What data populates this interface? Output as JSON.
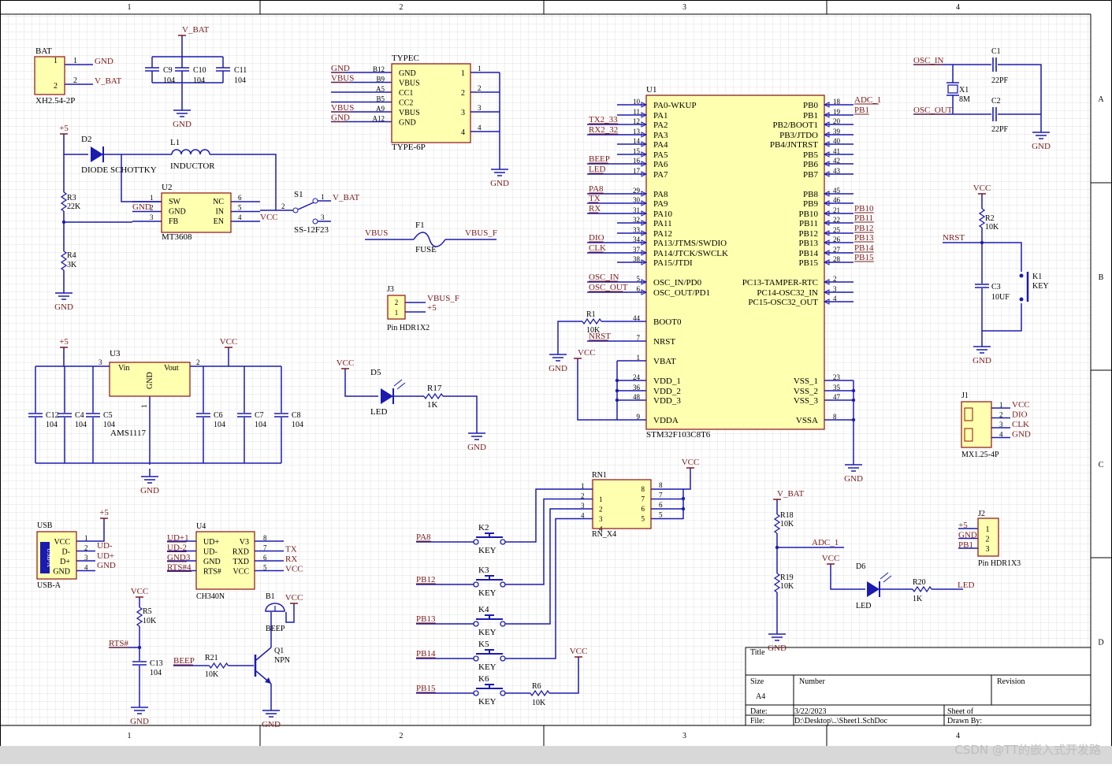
{
  "frame": {
    "columns": [
      "1",
      "2",
      "3",
      "4"
    ],
    "rows": [
      "A",
      "B",
      "C",
      "D"
    ]
  },
  "title_block": {
    "title_label": "Title",
    "size_label": "Size",
    "size_value": "A4",
    "number_label": "Number",
    "revision_label": "Revision",
    "date_label": "Date:",
    "date_value": "3/22/2023",
    "file_label": "File:",
    "file_value": "D:\\Desktop\\..\\Sheet1.SchDoc",
    "sheet_label": "Sheet  of",
    "drawn_label": "Drawn By:"
  },
  "watermark": "CSDN @TT的嵌入式开发路",
  "components": {
    "bat": {
      "ref": "BAT",
      "value": "XH2.54-2P",
      "pins": [
        "1",
        "2"
      ],
      "nets": [
        "GND",
        "V_BAT"
      ]
    },
    "caps_top": {
      "net_top": "V_BAT",
      "net_bottom": "GND",
      "refs": [
        "C9",
        "C10",
        "C11"
      ],
      "values": [
        "104",
        "104",
        "104"
      ]
    },
    "typec": {
      "ref": "TYPEC",
      "value": "TYPE-6P",
      "left_nets": [
        "GND",
        "VBUS",
        "",
        "",
        "VBUS",
        "GND"
      ],
      "left_pins": [
        "B12",
        "B9",
        "A5",
        "B5",
        "A9",
        "A12"
      ],
      "labels": [
        "GND",
        "VBUS",
        "CC1",
        "CC2",
        "VBUS",
        "GND"
      ],
      "right_pins": [
        "1",
        "2",
        "3",
        "4"
      ],
      "gnd": "GND"
    },
    "boost": {
      "ref": "U2",
      "value": "MT3608",
      "d2": "D2",
      "d2_value": "DIODE SCHOTTKY",
      "l1": "L1",
      "l1_value": "INDUCTOR",
      "labels_left": [
        "SW",
        "GND",
        "FB"
      ],
      "labels_right": [
        "NC",
        "IN",
        "EN"
      ],
      "pins_left": [
        "1",
        "2",
        "3"
      ],
      "pins_right": [
        "6",
        "5",
        "4"
      ],
      "plus5": "+5",
      "gnd_net": "GND",
      "vcc_net": "VCC",
      "r3": "R3",
      "r3_value": "22K",
      "r4": "R4",
      "r4_value": "3K",
      "gnd": "GND"
    },
    "switch": {
      "ref": "S1",
      "value": "SS-12F23",
      "net": "V_BAT",
      "pins": [
        "1",
        "2",
        "3"
      ]
    },
    "fuse": {
      "ref": "F1",
      "value": "FUSE",
      "net_in": "VBUS",
      "net_out": "VBUS_F"
    },
    "j3": {
      "ref": "J3",
      "value": "Pin HDR1X2",
      "pins": [
        "2",
        "1"
      ],
      "nets": [
        "VBUS_F",
        "+5"
      ]
    },
    "mcu": {
      "ref": "U1",
      "value": "STM32F103C8T6",
      "left": [
        {
          "pin": "10",
          "label": "PA0-WKUP",
          "net": ""
        },
        {
          "pin": "11",
          "label": "PA1",
          "net": ""
        },
        {
          "pin": "12",
          "label": "PA2",
          "net": "TX2_33"
        },
        {
          "pin": "13",
          "label": "PA3",
          "net": "RX2_32"
        },
        {
          "pin": "14",
          "label": "PA4",
          "net": ""
        },
        {
          "pin": "15",
          "label": "PA5",
          "net": ""
        },
        {
          "pin": "16",
          "label": "PA6",
          "net": "BEEP"
        },
        {
          "pin": "17",
          "label": "PA7",
          "net": "LED"
        },
        {
          "pin": "29",
          "label": "PA8",
          "net": "PA8"
        },
        {
          "pin": "30",
          "label": "PA9",
          "net": "TX"
        },
        {
          "pin": "31",
          "label": "PA10",
          "net": "RX"
        },
        {
          "pin": "32",
          "label": "PA11",
          "net": ""
        },
        {
          "pin": "33",
          "label": "PA12",
          "net": ""
        },
        {
          "pin": "34",
          "label": "PA13/JTMS/SWDIO",
          "net": "DIO"
        },
        {
          "pin": "37",
          "label": "PA14/JTCK/SWCLK",
          "net": "CLK"
        },
        {
          "pin": "38",
          "label": "PA15/JTDI",
          "net": ""
        },
        {
          "pin": "5",
          "label": "OSC_IN/PD0",
          "net": "OSC_IN"
        },
        {
          "pin": "6",
          "label": "OSC_OUT/PD1",
          "net": "OSC_OUT"
        },
        {
          "pin": "44",
          "label": "BOOT0",
          "net": ""
        },
        {
          "pin": "7",
          "label": "NRST",
          "net": "NRST"
        },
        {
          "pin": "1",
          "label": "VBAT",
          "net": ""
        },
        {
          "pin": "24",
          "label": "VDD_1",
          "net": ""
        },
        {
          "pin": "36",
          "label": "VDD_2",
          "net": ""
        },
        {
          "pin": "48",
          "label": "VDD_3",
          "net": ""
        },
        {
          "pin": "9",
          "label": "VDDA",
          "net": ""
        }
      ],
      "right": [
        {
          "pin": "18",
          "label": "PB0",
          "net": "ADC_1"
        },
        {
          "pin": "19",
          "label": "PB1",
          "net": "PB1"
        },
        {
          "pin": "20",
          "label": "PB2/BOOT1",
          "net": ""
        },
        {
          "pin": "39",
          "label": "PB3/JTDO",
          "net": ""
        },
        {
          "pin": "40",
          "label": "PB4/JNTRST",
          "net": ""
        },
        {
          "pin": "41",
          "label": "PB5",
          "net": ""
        },
        {
          "pin": "42",
          "label": "PB6",
          "net": ""
        },
        {
          "pin": "43",
          "label": "PB7",
          "net": ""
        },
        {
          "pin": "45",
          "label": "PB8",
          "net": ""
        },
        {
          "pin": "46",
          "label": "PB9",
          "net": ""
        },
        {
          "pin": "21",
          "label": "PB10",
          "net": "PB10"
        },
        {
          "pin": "22",
          "label": "PB11",
          "net": "PB11"
        },
        {
          "pin": "25",
          "label": "PB12",
          "net": "PB12"
        },
        {
          "pin": "26",
          "label": "PB13",
          "net": "PB13"
        },
        {
          "pin": "27",
          "label": "PB14",
          "net": "PB14"
        },
        {
          "pin": "28",
          "label": "PB15",
          "net": "PB15"
        },
        {
          "pin": "2",
          "label": "PC13-TAMPER-RTC",
          "net": ""
        },
        {
          "pin": "3",
          "label": "PC14-OSC32_IN",
          "net": ""
        },
        {
          "pin": "4",
          "label": "PC15-OSC32_OUT",
          "net": ""
        },
        {
          "pin": "23",
          "label": "VSS_1",
          "net": ""
        },
        {
          "pin": "35",
          "label": "VSS_2",
          "net": ""
        },
        {
          "pin": "47",
          "label": "VSS_3",
          "net": ""
        },
        {
          "pin": "8",
          "label": "VSSA",
          "net": ""
        }
      ],
      "r1": "R1",
      "r1_value": "10K",
      "vcc": "VCC",
      "gnd": "GND"
    },
    "crystal": {
      "osc_in": "OSC_IN",
      "osc_out": "OSC_OUT",
      "x1": "X1",
      "x1_value": "8M",
      "c1": "C1",
      "c1_value": "22PF",
      "c2": "C2",
      "c2_value": "22PF",
      "gnd": "GND"
    },
    "reset": {
      "vcc": "VCC",
      "r2": "R2",
      "r2_value": "10K",
      "nrst": "NRST",
      "c3": "C3",
      "c3_value": "10UF",
      "k1": "K1",
      "k1_value": "KEY",
      "gnd": "GND"
    },
    "j1": {
      "ref": "J1",
      "value": "MX1.25-4P",
      "pins": [
        "1",
        "2",
        "3",
        "4"
      ],
      "nets": [
        "VCC",
        "DIO",
        "CLK",
        "GND"
      ]
    },
    "ldo": {
      "ref": "U3",
      "value": "AMS1117",
      "vin": "Vin",
      "vout": "Vout",
      "gndlabel": "GND",
      "plus5": "+5",
      "vcc": "VCC",
      "pins": [
        "3",
        "2",
        "1"
      ],
      "caps_left": [
        "C12",
        "C4",
        "C5"
      ],
      "caps_right": [
        "C6",
        "C7",
        "C8"
      ],
      "cap_value": "104",
      "gnd": "GND"
    },
    "led5": {
      "vcc": "VCC",
      "ref": "D5",
      "value": "LED",
      "r": "R17",
      "r_value": "1K",
      "gnd": "GND"
    },
    "rn1": {
      "ref": "RN1",
      "value": "RN_X4",
      "pins_left": [
        "1",
        "2",
        "3",
        "4"
      ],
      "pins_right": [
        "8",
        "7",
        "6",
        "5"
      ],
      "inner_left": [
        "1",
        "2",
        "3",
        "4"
      ],
      "inner_right": [
        "8",
        "7",
        "6",
        "5"
      ],
      "vcc": "VCC"
    },
    "keys": [
      {
        "ref": "K2",
        "value": "KEY",
        "net": "PA8"
      },
      {
        "ref": "K3",
        "value": "KEY",
        "net": "PB12"
      },
      {
        "ref": "K4",
        "value": "KEY",
        "net": "PB13"
      },
      {
        "ref": "K5",
        "value": "KEY",
        "net": "PB14"
      },
      {
        "ref": "K6",
        "value": "KEY",
        "net": "PB15"
      }
    ],
    "r6": {
      "ref": "R6",
      "value": "10K",
      "vcc": "VCC"
    },
    "usb": {
      "ref": "USB",
      "value": "USB-A",
      "inner": "USB-A",
      "labels": [
        "VCC",
        "D-",
        "D+",
        "GND"
      ],
      "pins": [
        "1",
        "2",
        "3",
        "4"
      ],
      "nets": [
        "+5",
        "UD-",
        "UD+",
        "GND"
      ]
    },
    "ch340": {
      "ref": "U4",
      "value": "CH340N",
      "left_nets": [
        "UD+1",
        "UD-2",
        "GND3",
        "RTS#4"
      ],
      "left_labels": [
        "UD+",
        "UD-",
        "GND",
        "RTS#"
      ],
      "right_labels": [
        "V3",
        "RXD",
        "TXD",
        "VCC"
      ],
      "right_pins": [
        "8",
        "7",
        "6",
        "5"
      ],
      "right_nets": [
        "",
        "TX",
        "RX",
        "VCC"
      ]
    },
    "rts": {
      "vcc": "VCC",
      "r5": "R5",
      "r5_value": "10K",
      "net": "RTS#",
      "c13": "C13",
      "c13_value": "104",
      "gnd": "GND"
    },
    "beep": {
      "ref": "B1",
      "value": "BEEP",
      "vcc": "VCC",
      "net": "BEEP",
      "r21": "R21",
      "r21_value": "10K",
      "q1": "Q1",
      "q1_value": "NPN",
      "gnd": "GND"
    },
    "adc": {
      "vbat": "V_BAT",
      "r18": "R18",
      "r18_value": "10K",
      "r19": "R19",
      "r19_value": "10K",
      "net": "ADC_1",
      "gnd": "GND"
    },
    "led6": {
      "vcc": "VCC",
      "ref": "D6",
      "value": "LED",
      "r": "R20",
      "r_value": "1K",
      "net": "LED"
    },
    "j2": {
      "ref": "J2",
      "value": "Pin HDR1X3",
      "pins": [
        "1",
        "2",
        "3"
      ],
      "nets": [
        "+5",
        "GND",
        "PB1"
      ]
    }
  }
}
